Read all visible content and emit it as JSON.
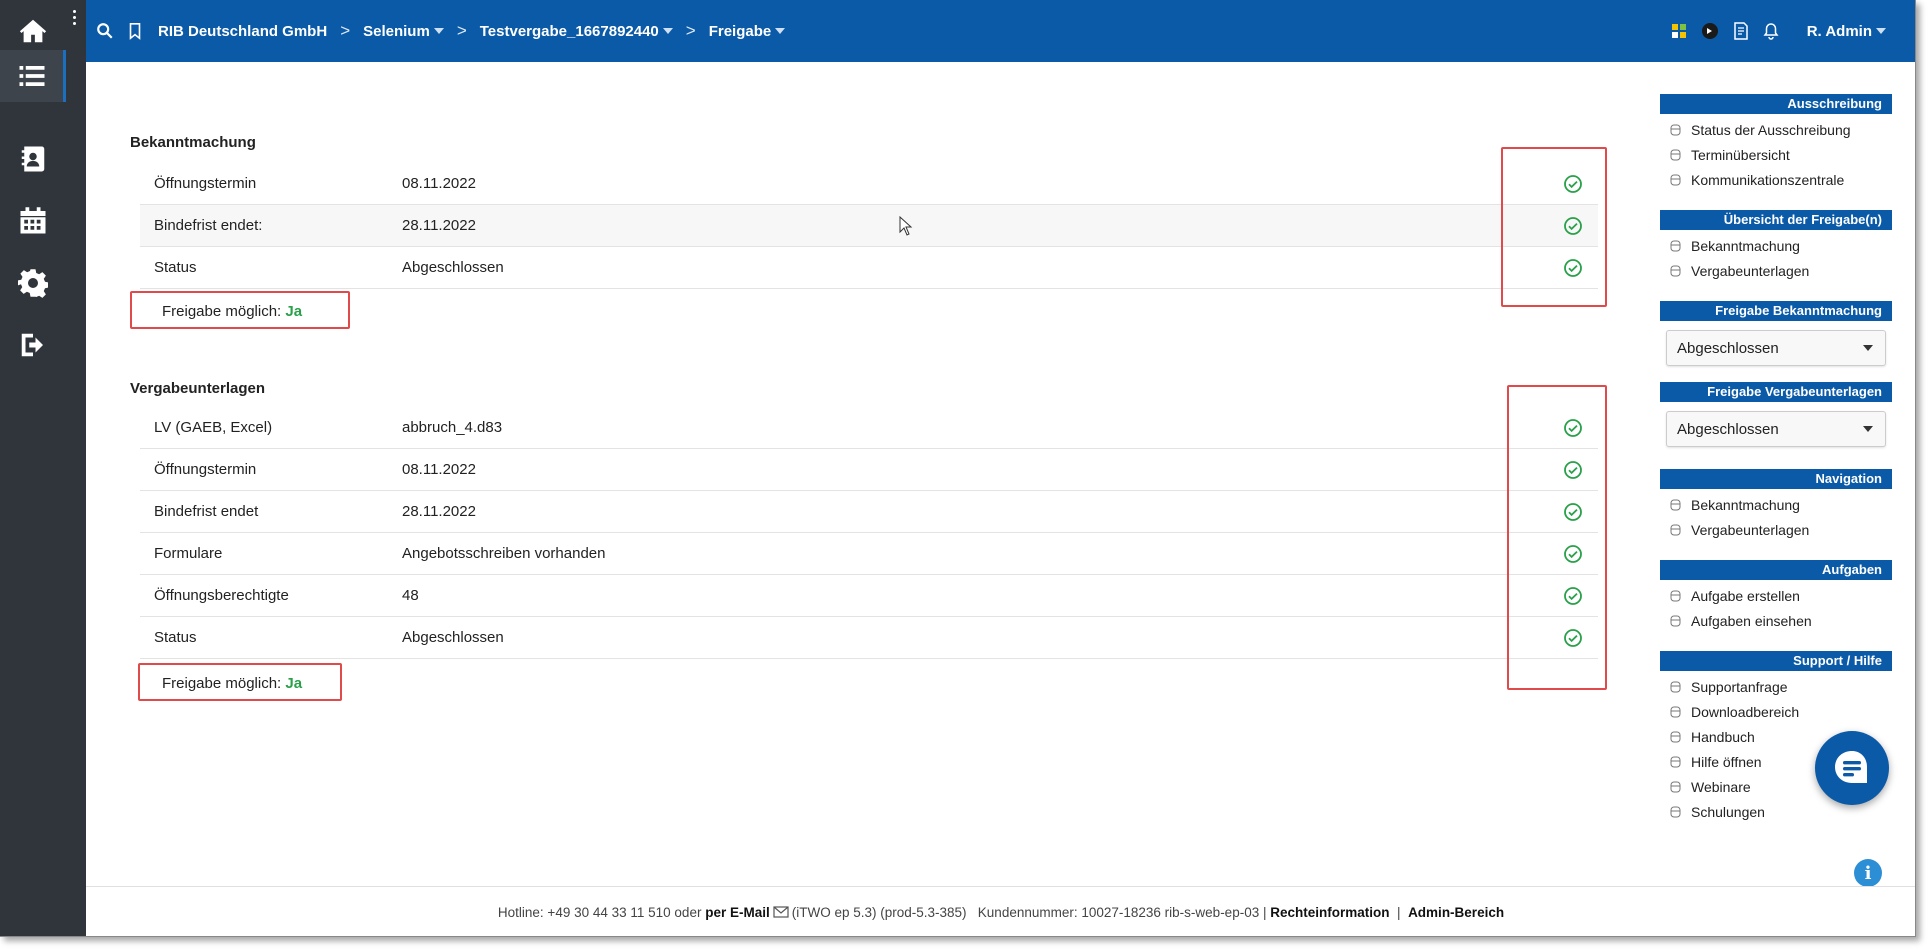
{
  "breadcrumbs": [
    {
      "label": "RIB Deutschland GmbH",
      "dropdown": false
    },
    {
      "label": "Selenium",
      "dropdown": true
    },
    {
      "label": "Testvergabe_1667892440",
      "dropdown": true
    },
    {
      "label": "Freigabe",
      "dropdown": true
    }
  ],
  "user": {
    "name": "R. Admin"
  },
  "sidebar": [
    "home-icon",
    "list-icon",
    "contacts-icon",
    "calendar-icon",
    "gear-icon",
    "logout-icon"
  ],
  "bekanntmachung": {
    "title": "Bekanntmachung",
    "rows": [
      {
        "label": "Öffnungstermin",
        "value": "08.11.2022"
      },
      {
        "label": "Bindefrist endet:",
        "value": "28.11.2022"
      },
      {
        "label": "Status",
        "value": "Abgeschlossen"
      }
    ],
    "freigabe_label": "Freigabe möglich:",
    "freigabe_value": "Ja"
  },
  "vergabeunterlagen": {
    "title": "Vergabeunterlagen",
    "rows": [
      {
        "label": "LV (GAEB, Excel)",
        "value": "abbruch_4.d83"
      },
      {
        "label": "Öffnungstermin",
        "value": "08.11.2022"
      },
      {
        "label": "Bindefrist endet",
        "value": "28.11.2022"
      },
      {
        "label": "Formulare",
        "value": "Angebotsschreiben vorhanden"
      },
      {
        "label": "Öffnungsberechtigte",
        "value": "48"
      },
      {
        "label": "Status",
        "value": "Abgeschlossen"
      }
    ],
    "freigabe_label": "Freigabe möglich:",
    "freigabe_value": "Ja"
  },
  "rpanel": {
    "ausschreibung": {
      "title": "Ausschreibung",
      "links": [
        "Status der Ausschreibung",
        "Terminübersicht",
        "Kommunikationszentrale"
      ]
    },
    "uebersicht": {
      "title": "Übersicht der Freigabe(n)",
      "links": [
        "Bekanntmachung",
        "Vergabeunterlagen"
      ]
    },
    "freigabe_bek": {
      "title": "Freigabe Bekanntmachung",
      "selected": "Abgeschlossen"
    },
    "freigabe_verg": {
      "title": "Freigabe Vergabeunterlagen",
      "selected": "Abgeschlossen"
    },
    "navigation": {
      "title": "Navigation",
      "links": [
        "Bekanntmachung",
        "Vergabeunterlagen"
      ]
    },
    "aufgaben": {
      "title": "Aufgaben",
      "links": [
        "Aufgabe erstellen",
        "Aufgaben einsehen"
      ]
    },
    "support": {
      "title": "Support / Hilfe",
      "links": [
        "Supportanfrage",
        "Downloadbereich",
        "Handbuch",
        "Hilfe öffnen",
        "Webinare",
        "Schulungen"
      ]
    }
  },
  "footer": {
    "hotline": "Hotline: +49 30 44 33 11 510 oder",
    "email": "per E-Mail",
    "version": "(iTWO ep 5.3) (prod-5.3-385)   Kundennummer: 10027-18236 rib-s-web-ep-03 |",
    "rechte": "Rechteinformation",
    "divider": "|",
    "admin": "Admin-Bereich"
  },
  "colors": {
    "brand": "#0a5aa8",
    "sidebar": "#2f353b",
    "success": "#2aa04a",
    "highlight": "#e14a4a"
  }
}
